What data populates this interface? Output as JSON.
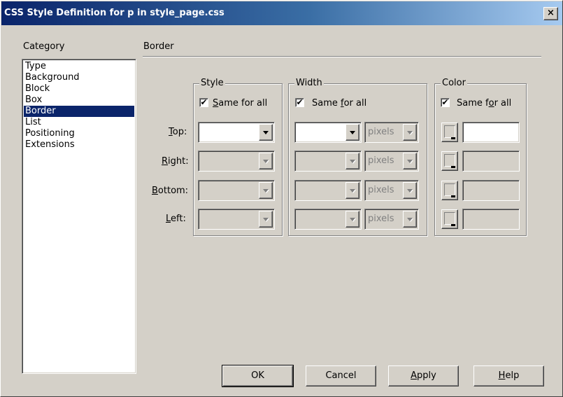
{
  "window": {
    "title": "CSS Style Definition for p in style_page.css",
    "close_glyph": "×"
  },
  "category": {
    "label": "Category",
    "items": [
      "Type",
      "Background",
      "Block",
      "Box",
      "Border",
      "List",
      "Positioning",
      "Extensions"
    ],
    "selected": "Border"
  },
  "panel": {
    "heading": "Border"
  },
  "style_group": {
    "legend": "Style",
    "same_for_all_pre": "",
    "same_for_all_key": "S",
    "same_for_all_post": "ame for all",
    "same_checked": true
  },
  "width_group": {
    "legend": "Width",
    "same_pre": "Same ",
    "same_key": "f",
    "same_post": "or all",
    "same_checked": true,
    "unit": "pixels"
  },
  "color_group": {
    "legend": "Color",
    "same_pre": "Same f",
    "same_key": "o",
    "same_post": "r all",
    "same_checked": true
  },
  "rows": [
    {
      "key": "T",
      "rest": "op:",
      "enabled": true
    },
    {
      "key": "R",
      "rest": "ight:",
      "enabled": false
    },
    {
      "key": "B",
      "rest": "ottom:",
      "enabled": false
    },
    {
      "key": "L",
      "rest": "eft:",
      "enabled": false
    }
  ],
  "buttons": {
    "ok": "OK",
    "cancel": "Cancel",
    "apply_key": "A",
    "apply_rest": "pply",
    "help_key": "H",
    "help_rest": "elp"
  },
  "check_glyph": "✔"
}
